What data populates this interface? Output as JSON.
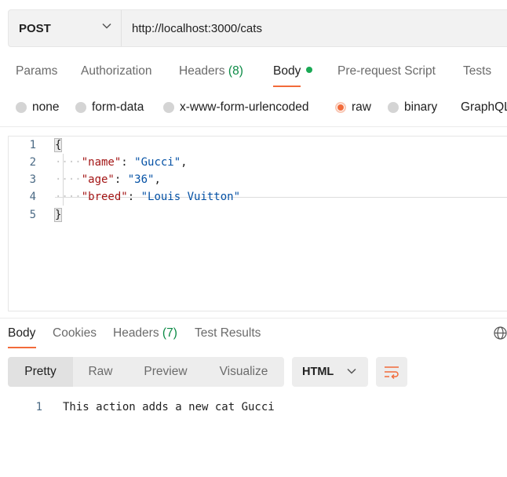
{
  "request": {
    "method": "POST",
    "url": "http://localhost:3000/cats"
  },
  "request_tabs": {
    "params": "Params",
    "authorization": "Authorization",
    "headers": "Headers",
    "headers_count": "(8)",
    "body": "Body",
    "pre_request": "Pre-request Script",
    "tests": "Tests"
  },
  "body_types": {
    "none": "none",
    "form_data": "form-data",
    "urlencoded": "x-www-form-urlencoded",
    "raw": "raw",
    "binary": "binary",
    "graphql": "GraphQL",
    "selected": "raw"
  },
  "editor": {
    "line_numbers": [
      "1",
      "2",
      "3",
      "4",
      "5"
    ],
    "open_brace": "{",
    "close_brace": "}",
    "indent": "····",
    "lines": [
      {
        "key": "\"name\"",
        "sep": ": ",
        "value": "\"Gucci\"",
        "trail": ","
      },
      {
        "key": "\"age\"",
        "sep": ": ",
        "value": "\"36\"",
        "trail": ","
      },
      {
        "key": "\"breed\"",
        "sep": ": ",
        "value": "\"Louis Vuitton\"",
        "trail": ""
      }
    ]
  },
  "response_tabs": {
    "body": "Body",
    "cookies": "Cookies",
    "headers": "Headers",
    "headers_count": "(7)",
    "test_results": "Test Results"
  },
  "response_view": {
    "pretty": "Pretty",
    "raw": "Raw",
    "preview": "Preview",
    "visualize": "Visualize",
    "format": "HTML"
  },
  "response": {
    "line_number": "1",
    "text": "This action adds a new cat Gucci"
  },
  "colors": {
    "accent": "#f26b3a",
    "status_green": "#1aa955"
  }
}
